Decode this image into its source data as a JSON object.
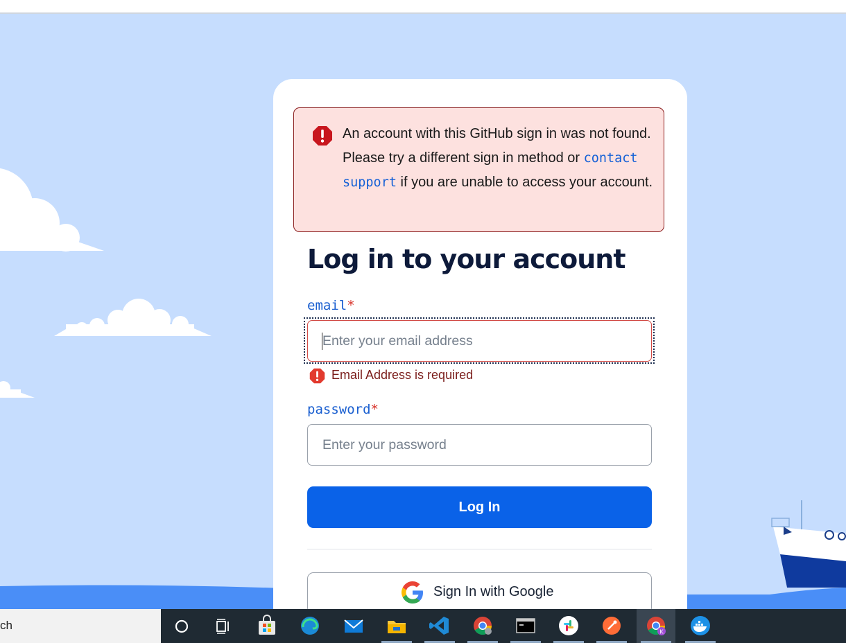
{
  "alert": {
    "text_before": "An account with this GitHub sign in was not found. Please try a different sign in method or ",
    "link": "contact support",
    "text_after": " if you are unable to access your account."
  },
  "form": {
    "title": "Log in to your account",
    "email": {
      "label": "email",
      "required_mark": "*",
      "placeholder": "Enter your email address",
      "error": "Email Address is required"
    },
    "password": {
      "label": "password",
      "required_mark": "*",
      "placeholder": "Enter your password"
    },
    "login_button": "Log In",
    "google_button": "Sign In with Google"
  },
  "taskbar": {
    "search_text": "ch",
    "apps": [
      {
        "icon": "cortana-circle-icon"
      },
      {
        "icon": "task-view-icon"
      },
      {
        "icon": "microsoft-store-icon"
      },
      {
        "icon": "edge-icon"
      },
      {
        "icon": "mail-icon"
      },
      {
        "icon": "file-explorer-icon"
      },
      {
        "icon": "vscode-icon"
      },
      {
        "icon": "chrome-icon"
      },
      {
        "icon": "terminal-icon"
      },
      {
        "icon": "slack-icon"
      },
      {
        "icon": "postman-icon"
      },
      {
        "icon": "chrome-profile-icon",
        "active": true
      },
      {
        "icon": "docker-icon"
      }
    ]
  },
  "colors": {
    "background": "#c6ddfe",
    "primary_button": "#0a62e8",
    "error": "#d8322a",
    "alert_bg": "#fde1df",
    "heading": "#0d1a3a"
  }
}
